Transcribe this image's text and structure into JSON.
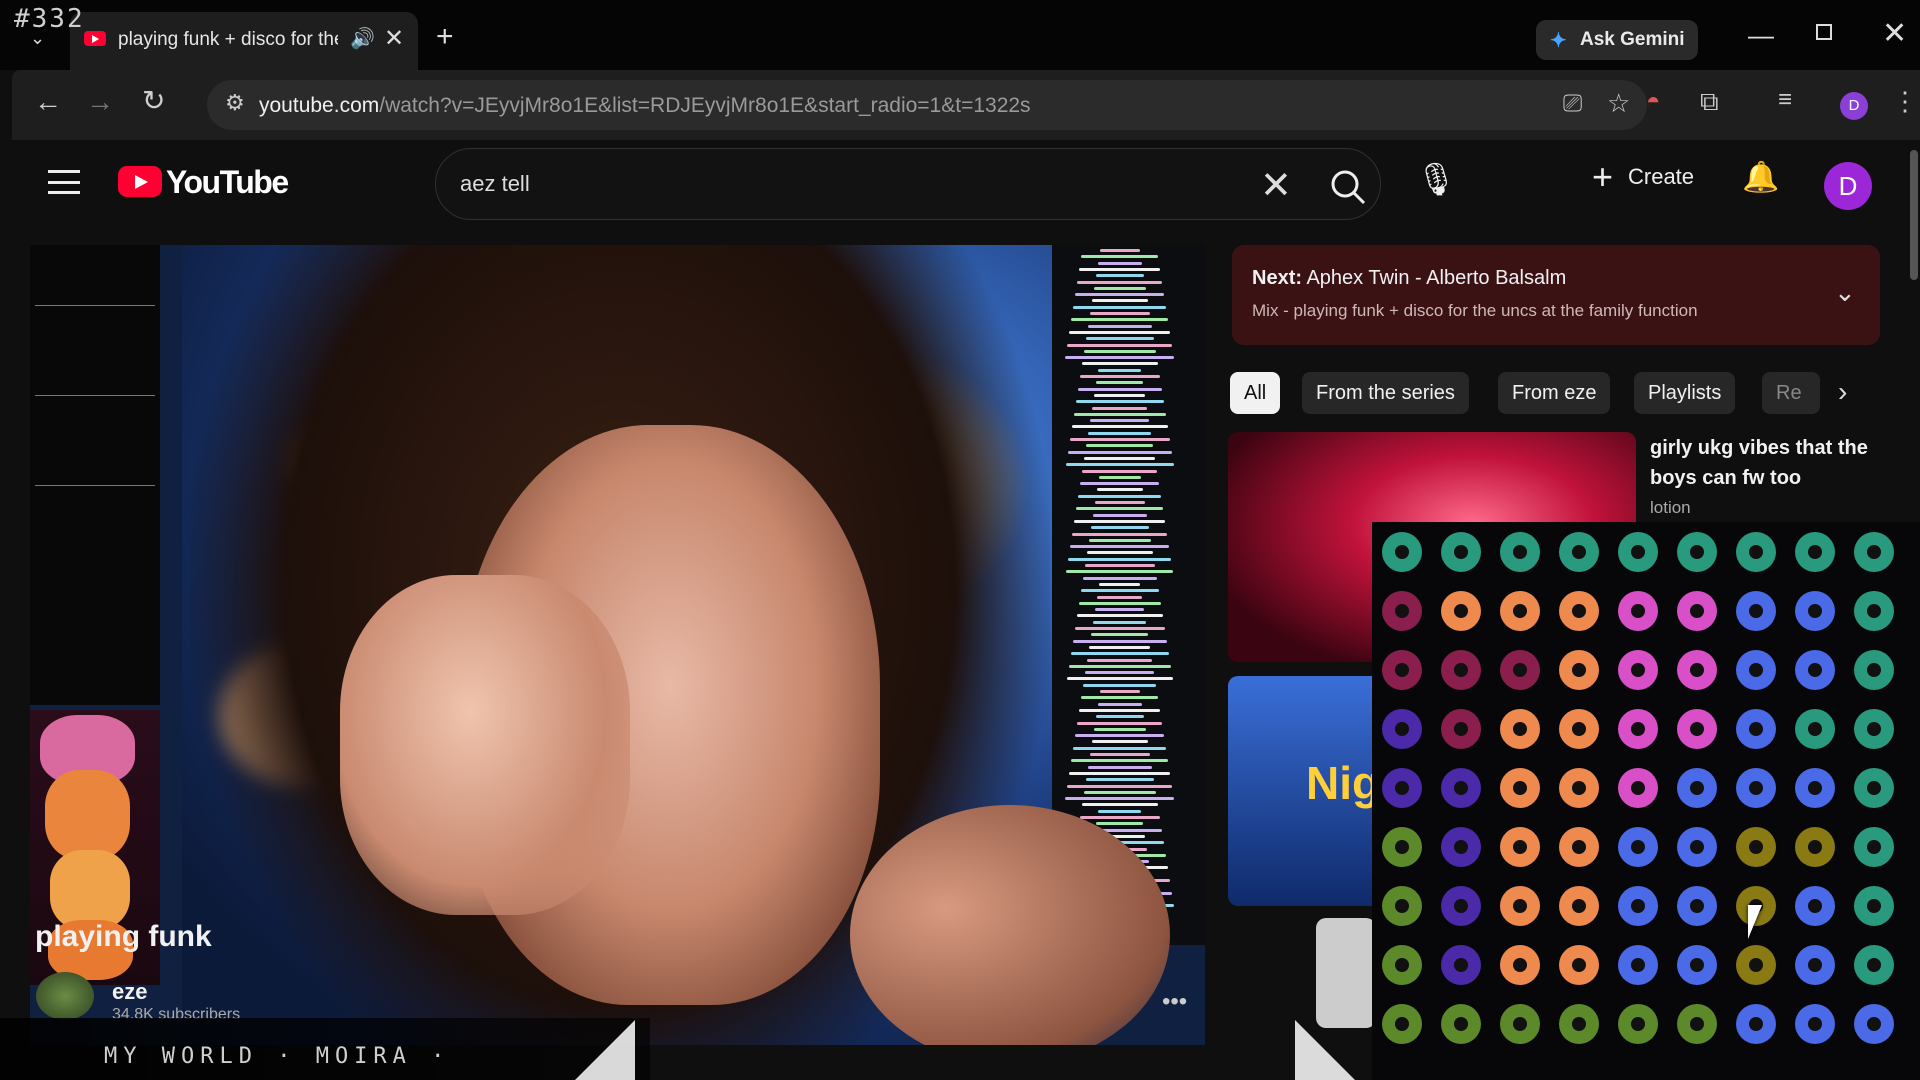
{
  "overlay": {
    "frame_number": "#332",
    "ticker_text": "MY WORLD · MOIRA ·"
  },
  "browser": {
    "tab_title": "playing funk + disco for the uncs at the family function",
    "gemini_label": "Ask Gemini",
    "url_host": "youtube.com",
    "url_rest": "/watch?v=JEyvjMr8o1E&list=RDJEyvjMr8o1E&start_radio=1&t=1322s",
    "profile_initial": "D"
  },
  "youtube": {
    "logo_text": "YouTube",
    "search_value": "aez           tell",
    "create_label": "Create",
    "avatar_initial": "D"
  },
  "video": {
    "title": "playing funk",
    "channel": "eze",
    "subscribers": "34.8K subscribers"
  },
  "up_next": {
    "label": "Next:",
    "title": "Aphex Twin - Alberto Balsalm",
    "subtitle": "Mix - playing funk + disco for the uncs at the family function"
  },
  "chips": [
    "All",
    "From the series",
    "From eze",
    "Playlists",
    "Re"
  ],
  "recommendations": [
    {
      "title": "girly ukg vibes that the boys can fw too",
      "channel": "lotion"
    },
    {
      "thumb_text": "Nig"
    }
  ],
  "colors": {
    "accent": "#ff0033",
    "next_bg": "#3a1214"
  },
  "icons": [
    "chevron-down-icon",
    "youtube-favicon-icon",
    "speaker-icon",
    "close-icon",
    "plus-icon",
    "gemini-icon",
    "minimize-icon",
    "maximize-icon",
    "back-icon",
    "forward-icon",
    "reload-icon",
    "site-info-icon",
    "install-icon",
    "star-icon",
    "incognito-icon",
    "extensions-icon",
    "media-icon",
    "menu-icon",
    "search-icon",
    "mic-icon",
    "bell-icon",
    "mouse-cursor-icon"
  ]
}
